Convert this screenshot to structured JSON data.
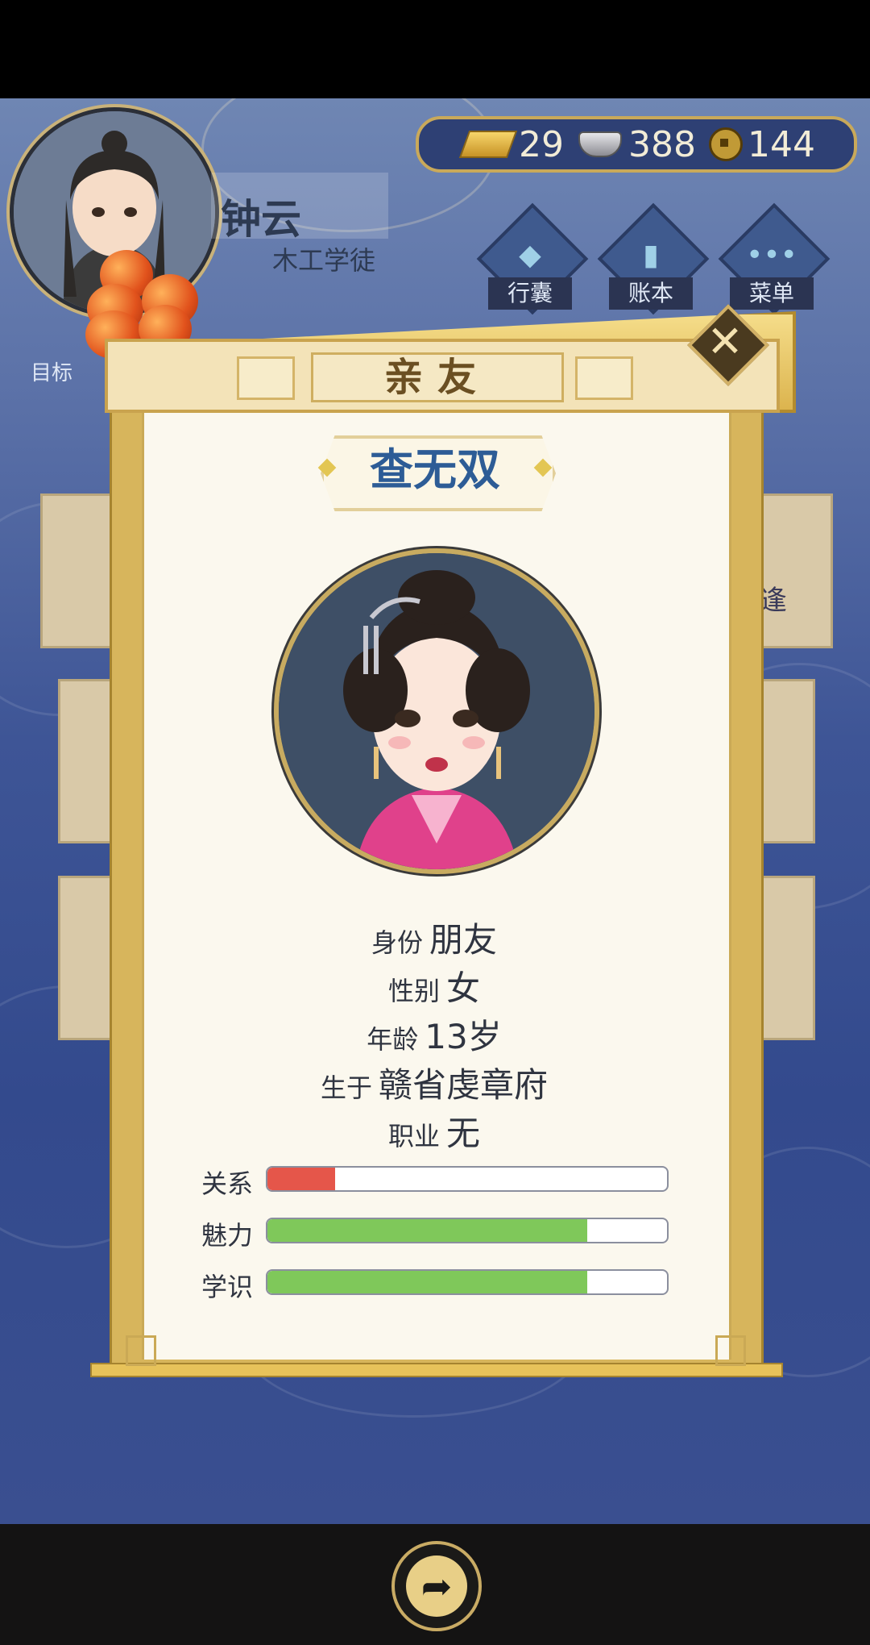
{
  "player": {
    "name": "钟云",
    "title": "木工学徒"
  },
  "currency": {
    "gold": "29",
    "silver": "388",
    "coins": "144"
  },
  "menu": [
    {
      "label": "行囊",
      "icon": "bag-icon"
    },
    {
      "label": "账本",
      "icon": "ledger-icon"
    },
    {
      "label": "菜单",
      "icon": "more-icon"
    }
  ],
  "goal_label": "目标",
  "background_side_text": "逢",
  "popup": {
    "header": "亲友",
    "close": "✕",
    "person_name": "查无双",
    "info": [
      {
        "label": "身份",
        "value": "朋友"
      },
      {
        "label": "性别",
        "value": "女"
      },
      {
        "label": "年龄",
        "value": "13岁"
      },
      {
        "label": "生于",
        "value": "赣省虔章府"
      },
      {
        "label": "职业",
        "value": "无"
      }
    ],
    "stats": [
      {
        "label": "关系",
        "fraction": 0.17,
        "color": "#e5564a"
      },
      {
        "label": "魅力",
        "fraction": 0.8,
        "color": "#7fc85a"
      },
      {
        "label": "学识",
        "fraction": 0.8,
        "color": "#7fc85a"
      }
    ]
  },
  "share_icon": "share-icon"
}
